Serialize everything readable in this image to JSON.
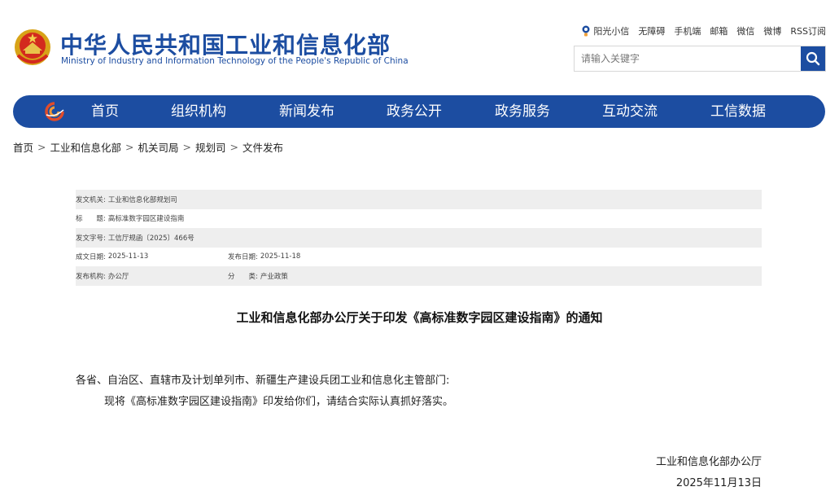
{
  "header": {
    "title": "中华人民共和国工业和信息化部",
    "subtitle": "Ministry of Industry and Information Technology of the People's Republic of China",
    "brand_color": "#1c4da1",
    "top_links": [
      "阳光小信",
      "无障碍",
      "手机端",
      "邮箱",
      "微信",
      "微博",
      "RSS订阅"
    ],
    "search": {
      "placeholder": "请输入关键字",
      "icon": "search-icon"
    }
  },
  "nav": {
    "items": [
      "首页",
      "组织机构",
      "新闻发布",
      "政务公开",
      "政务服务",
      "互动交流",
      "工信数据"
    ]
  },
  "breadcrumb": {
    "items": [
      "首页",
      "工业和信息化部",
      "机关司局",
      "规划司",
      "文件发布"
    ],
    "separator": ">"
  },
  "meta": {
    "issuer_label": "发文机关:",
    "issuer": "工业和信息化部规划司",
    "title_label": "标　　题:",
    "title": "高标准数字园区建设指南",
    "doc_no_label": "发文字号:",
    "doc_no": "工信厅规函〔2025〕466号",
    "written_label": "成文日期:",
    "written": "2025-11-13",
    "published_label": "发布日期:",
    "published": "2025-11-18",
    "agency_label": "发布机构:",
    "agency": "办公厅",
    "category_label": "分　　类:",
    "category": "产业政策"
  },
  "document": {
    "title": "工业和信息化部办公厅关于印发《高标准数字园区建设指南》的通知",
    "salutation": "各省、自治区、直辖市及计划单列市、新疆生产建设兵团工业和信息化主管部门:",
    "body": "现将《高标准数字园区建设指南》印发给你们，请结合实际认真抓好落实。",
    "signature": "工业和信息化部办公厅",
    "date": "2025年11月13日"
  }
}
